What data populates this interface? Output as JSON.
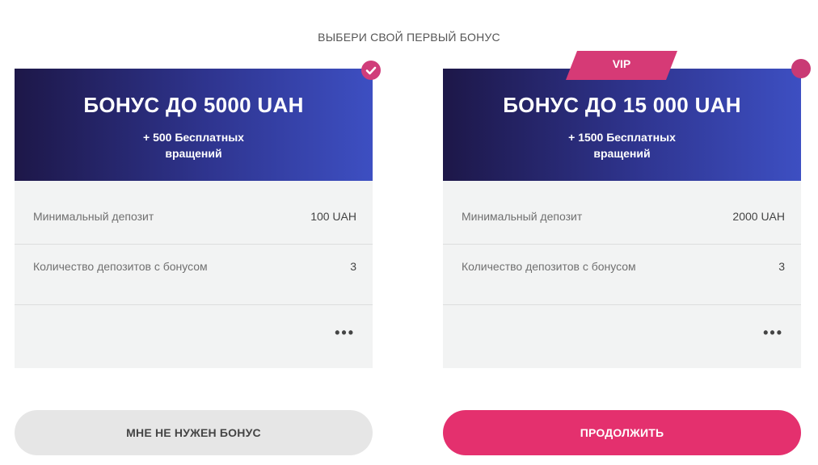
{
  "page": {
    "title": "ВЫБЕРИ СВОЙ ПЕРВЫЙ БОНУС"
  },
  "cards": [
    {
      "selected": true,
      "title": "БОНУС ДО 5000 UAH",
      "subtitle": "+ 500 Бесплатных вращений",
      "rows": [
        {
          "label": "Минимальный депозит",
          "value": "100 UAH"
        },
        {
          "label": "Количество депозитов с бонусом",
          "value": "3"
        }
      ],
      "more": "•••"
    },
    {
      "selected": false,
      "badge": "VIP",
      "title": "БОНУС ДО 15 000 UAH",
      "subtitle": "+ 1500 Бесплатных вращений",
      "rows": [
        {
          "label": "Минимальный депозит",
          "value": "2000 UAH"
        },
        {
          "label": "Количество депозитов с бонусом",
          "value": "3"
        }
      ],
      "more": "•••"
    }
  ],
  "buttons": {
    "no_bonus": "МНЕ НЕ НУЖЕН БОНУС",
    "continue": "ПРОДОЛЖИТЬ"
  },
  "icons": {
    "selected": "check-circle-icon",
    "unselected": "radio-dot-icon",
    "more": "more-dots-icon"
  },
  "colors": {
    "accent": "#e4306e",
    "header_dark": "#1d1748",
    "header_light": "#3d4fc2",
    "card_body": "#f2f3f3"
  }
}
